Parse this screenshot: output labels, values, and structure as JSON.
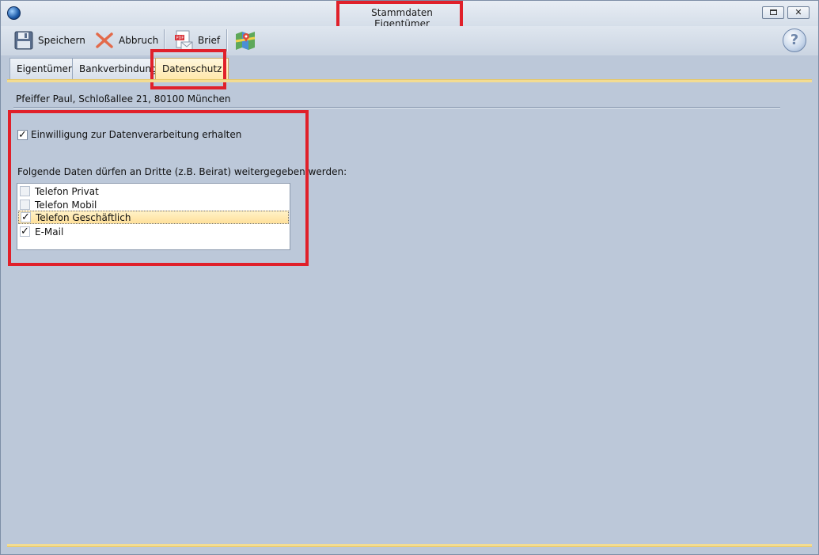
{
  "window": {
    "title": "Stammdaten Eigentümer"
  },
  "toolbar": {
    "save_label": "Speichern",
    "cancel_label": "Abbruch",
    "letter_label": "Brief"
  },
  "tabs": [
    {
      "label": "Eigentümer",
      "active": false
    },
    {
      "label": "Bankverbindung",
      "active": false
    },
    {
      "label": "Datenschutz",
      "active": true
    }
  ],
  "owner": {
    "summary": "Pfeiffer Paul, Schloßallee 21, 80100 München"
  },
  "privacy": {
    "consent_label": "Einwilligung zur Datenverarbeitung erhalten",
    "consent_checked": true,
    "share_label": "Folgende Daten dürfen an Dritte (z.B. Beirat) weitergegeben werden:",
    "items": [
      {
        "label": "Telefon Privat",
        "checked": false
      },
      {
        "label": "Telefon Mobil",
        "checked": false
      },
      {
        "label": "Telefon Geschäftlich",
        "checked": true,
        "selected": true
      },
      {
        "label": "E-Mail",
        "checked": true
      }
    ]
  },
  "colors": {
    "highlight": "#e0202a",
    "active_tab": "#ffe7a8",
    "background": "#bcc8d9"
  }
}
